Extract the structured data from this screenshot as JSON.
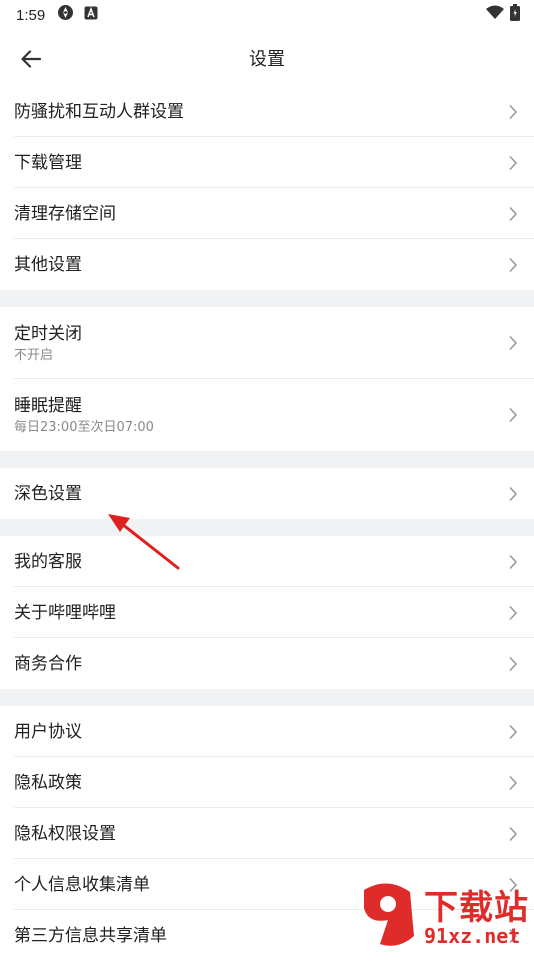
{
  "status_bar": {
    "time": "1:59",
    "icons": [
      "sync-icon",
      "a-notification-icon",
      "wifi-icon",
      "battery-icon"
    ]
  },
  "app_bar": {
    "title": "设置",
    "back_icon": "arrow-left-icon"
  },
  "groups": [
    {
      "items": [
        {
          "label": "防骚扰和互动人群设置"
        },
        {
          "label": "下载管理"
        },
        {
          "label": "清理存储空间"
        },
        {
          "label": "其他设置"
        }
      ]
    },
    {
      "items": [
        {
          "label": "定时关闭",
          "sub": "不开启"
        },
        {
          "label": "睡眠提醒",
          "sub": "每日23:00至次日07:00"
        }
      ]
    },
    {
      "items": [
        {
          "label": "深色设置"
        }
      ]
    },
    {
      "items": [
        {
          "label": "我的客服"
        },
        {
          "label": "关于哔哩哔哩"
        },
        {
          "label": "商务合作"
        }
      ]
    },
    {
      "items": [
        {
          "label": "用户协议"
        },
        {
          "label": "隐私政策"
        },
        {
          "label": "隐私权限设置"
        },
        {
          "label": "个人信息收集清单"
        },
        {
          "label": "第三方信息共享清单"
        }
      ]
    }
  ],
  "watermark": {
    "top": "下载站",
    "bottom": "91xz.net"
  },
  "colors": {
    "divider_bg": "#f1f2f3",
    "chevron": "#9a9a9a",
    "annotation_arrow": "#e02020",
    "watermark": "#e02b2b"
  }
}
